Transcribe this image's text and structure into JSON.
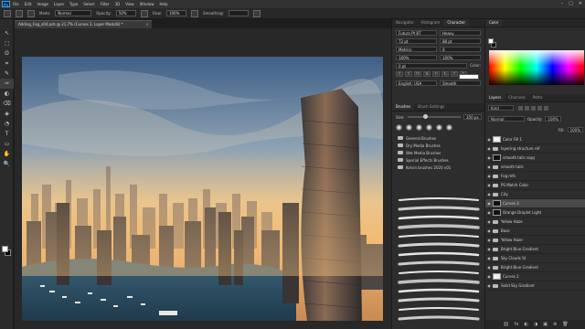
{
  "menu": {
    "logo": "Ps",
    "items": [
      "File",
      "Edit",
      "Image",
      "Layer",
      "Type",
      "Select",
      "Filter",
      "3D",
      "View",
      "Window",
      "Help"
    ],
    "window_controls": [
      "–",
      "□",
      "✕"
    ]
  },
  "options": {
    "mode_label": "Mode:",
    "mode_value": "Normal",
    "opacity_label": "Opacity:",
    "opacity_value": "50%",
    "flow_label": "Flow:",
    "flow_value": "100%",
    "smoothing_label": "Smoothing:",
    "smoothing_value": ""
  },
  "document": {
    "tab_title": "Adding_Fog_s04.psb @ 21,7% (Curves 3, Layer Mask/8) *",
    "close": "×"
  },
  "toolbar": {
    "tools": [
      "↖",
      "⬚",
      "ʘ",
      "⌗",
      "✎",
      "✑",
      "◐",
      "⌫",
      "◈",
      "◔",
      "T",
      "▭",
      "✋",
      "🔍"
    ]
  },
  "mid_dock": {
    "top_tabs": [
      "Navigator",
      "Histogram",
      "Character"
    ],
    "character": {
      "font_family": "Futura Pt BT",
      "font_style": "Heavy",
      "font_size": "72 pt",
      "leading": "88 pt",
      "kerning": "Metrics",
      "tracking": "0",
      "vertical_scale": "100%",
      "horizontal_scale": "100%",
      "baseline": "0 pt",
      "color_label": "Color:",
      "language": "English: USA",
      "aa": "Smooth"
    },
    "brush_tabs": [
      "Brushes",
      "Brush Settings"
    ],
    "brush_size_label": "Size:",
    "brush_size_value": "350 px",
    "folders": [
      "General Brushes",
      "Dry Media Brushes",
      "Wet Media Brushes",
      "Special Effects Brushes",
      "Kelvin brushes 2020 v01"
    ]
  },
  "right_dock": {
    "color_tabs": [
      "Color"
    ],
    "layer_tabs": [
      "Layers",
      "Channels",
      "Paths"
    ],
    "kind_label": "Kind",
    "blend_mode": "Normal",
    "opacity_label": "Opacity:",
    "opacity_value": "100%",
    "fill_label": "Fill:",
    "fill_value": "100%",
    "layers": [
      {
        "name": "Color Fill 1",
        "type": "layer",
        "thumb": "white"
      },
      {
        "name": "layering structure ref",
        "type": "folder"
      },
      {
        "name": "smooth tails copy",
        "type": "layer",
        "thumb": "dark"
      },
      {
        "name": "smooth tails",
        "type": "folder"
      },
      {
        "name": "Fog refs",
        "type": "folder"
      },
      {
        "name": "PS Match Color",
        "type": "folder"
      },
      {
        "name": "City",
        "type": "folder"
      },
      {
        "name": "Curves 3",
        "type": "layer",
        "thumb": "dark",
        "selected": true
      },
      {
        "name": "Orange Droplet Light",
        "type": "layer",
        "thumb": "dark"
      },
      {
        "name": "Yellow Haze",
        "type": "folder"
      },
      {
        "name": "Base",
        "type": "folder"
      },
      {
        "name": "Yellow Haze",
        "type": "folder"
      },
      {
        "name": "Bright Blue Gradient",
        "type": "folder"
      },
      {
        "name": "Sky Clouds St",
        "type": "folder"
      },
      {
        "name": "Bright Blue Gradient",
        "type": "folder"
      },
      {
        "name": "Curves 2",
        "type": "layer",
        "thumb": "white"
      },
      {
        "name": "Solid Sky Gradient",
        "type": "folder"
      }
    ],
    "footer_icons": [
      "⛓",
      "fx",
      "◐",
      "◑",
      "▣",
      "⊕",
      "🗑"
    ]
  },
  "colors": {
    "accent": "#31a8ff",
    "ui_dark": "#2d2d2d",
    "selection": "#4a4a4a"
  }
}
